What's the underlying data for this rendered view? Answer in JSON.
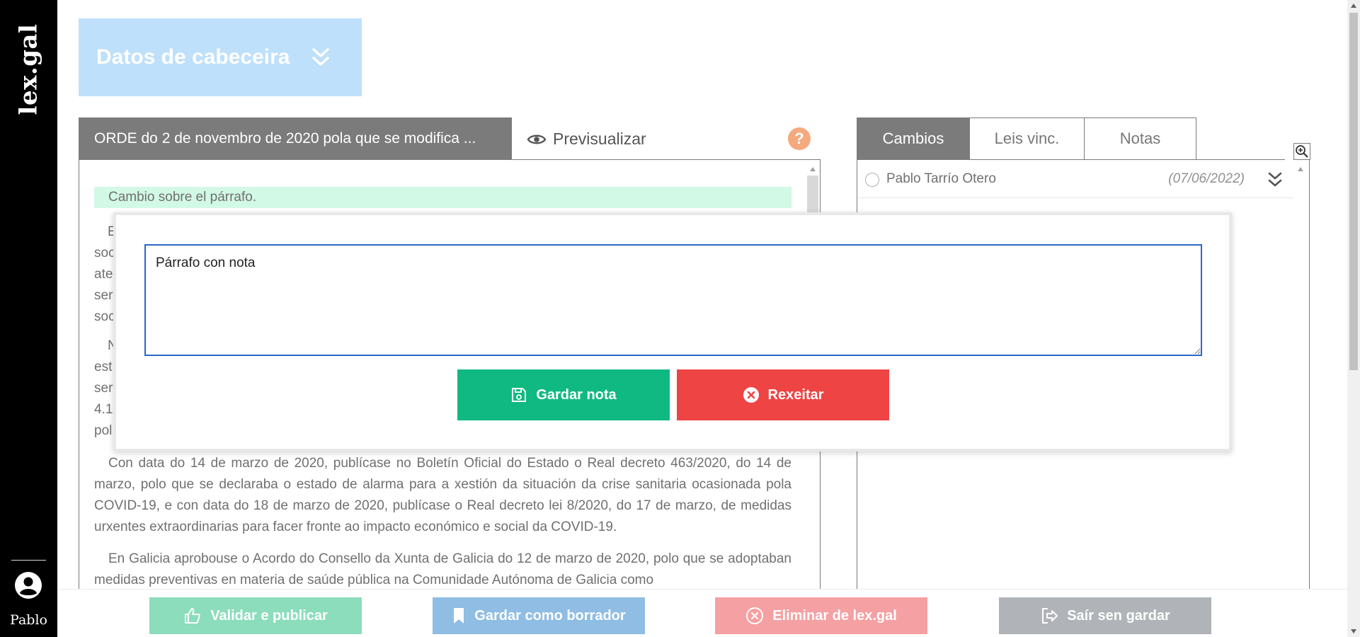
{
  "sidebar": {
    "logo": "lex.gal",
    "user_name": "Pablo"
  },
  "header": {
    "title": "Datos de cabeceira"
  },
  "document": {
    "tab_title": "ORDE do 2 de novembro de 2020 pola que se modifica ...",
    "preview_label": "Previsualizar",
    "help": "?",
    "change_note": "Cambio sobre el párrafo.",
    "fragments": [
      "E",
      "soc",
      "ate",
      "ser",
      "soc",
      "N",
      "est",
      "ser",
      "4.1",
      "pol"
    ],
    "paragraph_1": "Con data do 14 de marzo de 2020, publícase no Boletín Oficial do Estado o Real decreto 463/2020, do 14 de marzo, polo que se declaraba o estado de alarma para a xestión da situación da crise sanitaria ocasionada pola COVID-19, e con data do 18 de marzo de 2020, publícase o Real decreto lei 8/2020, do 17 de marzo, de medidas urxentes extraordinarias para facer fronte ao impacto económico e social da COVID-19.",
    "paragraph_2": "En Galicia aprobouse o Acordo do Consello da Xunta de Galicia do 12 de marzo de 2020, polo que se adoptaban medidas preventivas en materia de saúde pública na Comunidade Autónoma de Galicia como"
  },
  "right_panel": {
    "tabs": [
      "Cambios",
      "Leis vinc.",
      "Notas"
    ],
    "change": {
      "user": "Pablo Tarrío Otero",
      "date": "(07/06/2022)"
    }
  },
  "modal": {
    "note_value": "Párrafo con nota",
    "save_label": "Gardar nota",
    "reject_label": "Rexeitar"
  },
  "footer": {
    "validate_label": "Validar e publicar",
    "draft_label": "Gardar como borrador",
    "delete_label": "Eliminar de lex.gal",
    "exit_label": "Saír sen gardar"
  },
  "colors": {
    "sidebar": "#000000",
    "header": "#bee0fb",
    "tab_active": "#7b7b7b",
    "save": "#10b981",
    "reject": "#ef4444",
    "validate": "#8bddbc",
    "draft": "#8fbde3",
    "delete": "#f5a0a3",
    "exit": "#b0b4b8",
    "change_highlight": "#d2f8e6",
    "help": "#f5a97d"
  },
  "icons": {
    "header": "double-chevron-down-icon",
    "preview": "eye-icon",
    "zoom": "zoom-in-icon",
    "save": "floppy-disk-icon",
    "reject": "x-circle-icon",
    "validate": "thumbs-up-icon",
    "draft": "bookmark-icon",
    "delete": "x-circle-icon",
    "exit": "sign-out-icon",
    "user": "user-circle-icon"
  }
}
